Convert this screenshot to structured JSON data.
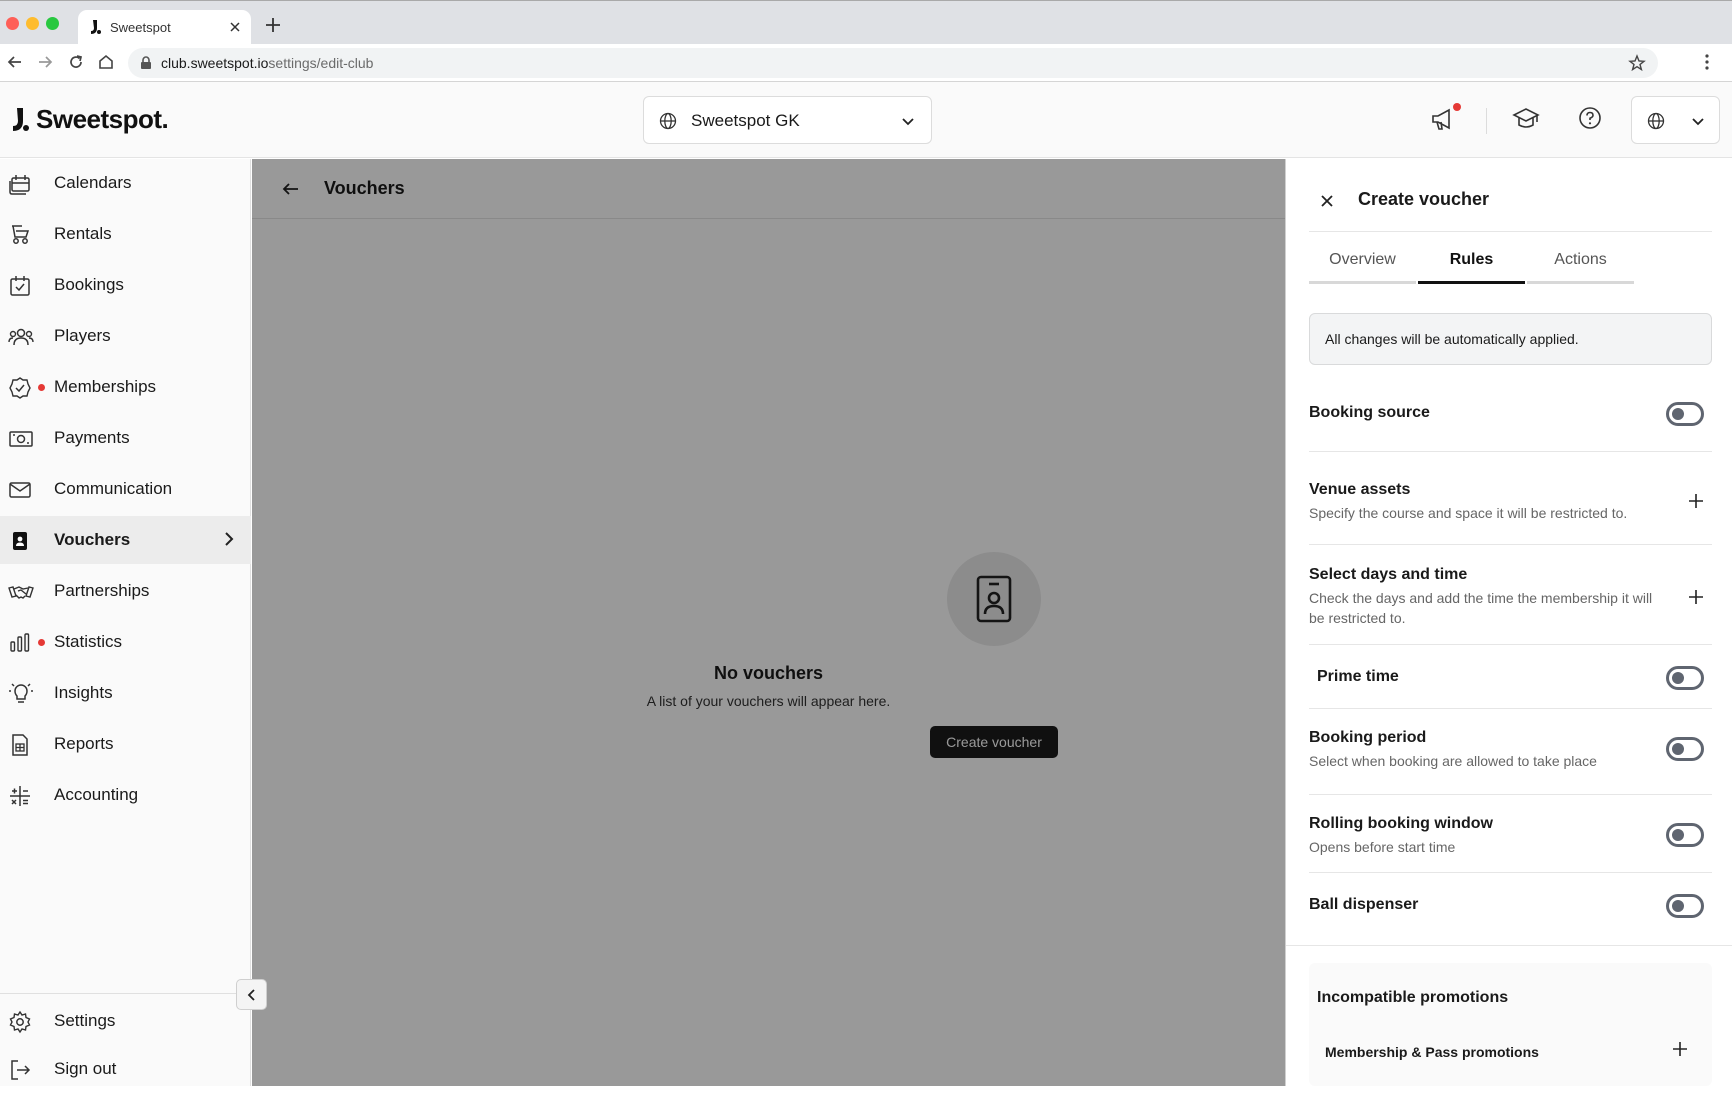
{
  "browser": {
    "tab_title": "Sweetspot",
    "url_host": "club.sweetspot.io",
    "url_path": "settings/edit-club",
    "icons": [
      "back-icon",
      "forward-icon",
      "reload-icon",
      "home-icon",
      "lock-icon",
      "star-icon",
      "kebab-icon"
    ]
  },
  "header": {
    "brand": "Sweetspot.",
    "club_name": "Sweetspot GK",
    "icons": [
      "megaphone-icon",
      "graduation-cap-icon",
      "help-icon",
      "globe-icon"
    ],
    "notification_color": "#e53935"
  },
  "sidebar": {
    "items": [
      {
        "label": "Calendars",
        "icon": "calendar-icon"
      },
      {
        "label": "Rentals",
        "icon": "golf-cart-icon"
      },
      {
        "label": "Bookings",
        "icon": "booking-icon"
      },
      {
        "label": "Players",
        "icon": "players-icon"
      },
      {
        "label": "Memberships",
        "icon": "membership-icon",
        "dot": true
      },
      {
        "label": "Payments",
        "icon": "payments-icon"
      },
      {
        "label": "Communication",
        "icon": "envelope-icon"
      },
      {
        "label": "Vouchers",
        "icon": "voucher-icon",
        "active": true
      },
      {
        "label": "Partnerships",
        "icon": "handshake-icon"
      },
      {
        "label": "Statistics",
        "icon": "bar-chart-icon",
        "dot": true
      },
      {
        "label": "Insights",
        "icon": "lightbulb-icon"
      },
      {
        "label": "Reports",
        "icon": "report-icon"
      },
      {
        "label": "Accounting",
        "icon": "calculator-icon"
      }
    ],
    "footer": [
      {
        "label": "Settings",
        "icon": "gear-icon"
      },
      {
        "label": "Sign out",
        "icon": "sign-out-icon"
      }
    ]
  },
  "main": {
    "title": "Vouchers",
    "empty_title": "No vouchers",
    "empty_subtitle": "A list of your vouchers will appear here.",
    "create_button": "Create voucher"
  },
  "panel": {
    "title": "Create voucher",
    "tabs": [
      {
        "label": "Overview",
        "active": false
      },
      {
        "label": "Rules",
        "active": true
      },
      {
        "label": "Actions",
        "active": false
      }
    ],
    "notice": "All changes will be automatically applied.",
    "rules": [
      {
        "title": "Booking source",
        "control": "toggle",
        "on": false
      },
      {
        "title": "Venue assets",
        "desc": "Specify the course and space it will be restricted to.",
        "control": "plus"
      },
      {
        "title": "Select days and time",
        "desc": "Check the days and add the time the membership it will be restricted to.",
        "control": "plus"
      },
      {
        "title": "Prime time",
        "control": "toggle",
        "on": false
      },
      {
        "title": "Booking period",
        "desc": "Select when booking are allowed to take place",
        "control": "toggle",
        "on": false
      },
      {
        "title": "Rolling booking window",
        "desc": "Opens before start time",
        "control": "toggle",
        "on": false
      },
      {
        "title": "Ball dispenser",
        "control": "toggle",
        "on": false
      }
    ],
    "incompatible": {
      "title": "Incompatible promotions",
      "item": "Membership & Pass promotions"
    }
  }
}
